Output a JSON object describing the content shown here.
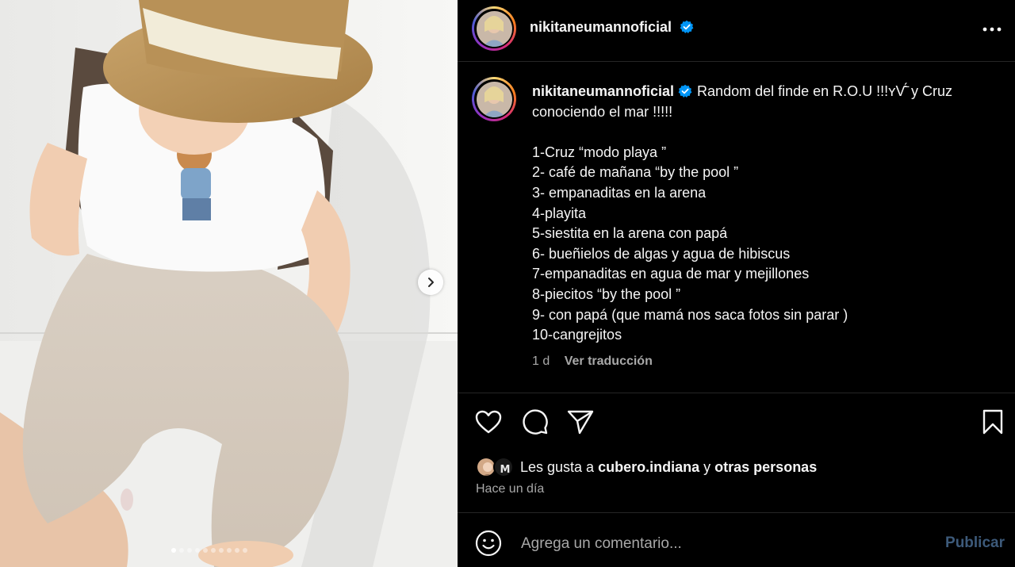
{
  "post": {
    "username": "nikitaneumannoficial",
    "caption_text": "Random del finde en R.O.U !!!ʏѴ́̄ y Cruz conociendo el mar !!!!!",
    "caption_list": [
      "1-Cruz “modo playa ”",
      "2- café de mañana “by the pool ”",
      "3- empanaditas en la arena",
      "4-playita",
      "5-siestita en la arena con papá",
      "6- bueñielos de algas y agua de hibiscus",
      "7-empanaditas en agua de mar y mejillones",
      "8-piecitos “by the pool ”",
      "9- con papá (que mamá nos saca fotos sin parar )",
      "10-cangrejitos"
    ],
    "age": "1 d",
    "translate_label": "Ver traducción"
  },
  "likes": {
    "prefix": "Les gusta a ",
    "user": "cubero.indiana",
    "middle": " y ",
    "others": "otras personas"
  },
  "timestamp": "Hace un día",
  "comment": {
    "placeholder": "Agrega un comentario...",
    "publish_label": "Publicar"
  },
  "carousel": {
    "total": 10,
    "current": 1
  },
  "colors": {
    "background": "#000000",
    "text": "#f5f5f5",
    "muted": "#a8a8a8",
    "verified": "#0095f6",
    "publish_disabled": "#3d5a7a"
  },
  "icons": [
    "more-options-icon",
    "verified-icon",
    "heart-icon",
    "comment-icon",
    "share-icon",
    "bookmark-icon",
    "emoji-icon",
    "chevron-right-icon"
  ]
}
